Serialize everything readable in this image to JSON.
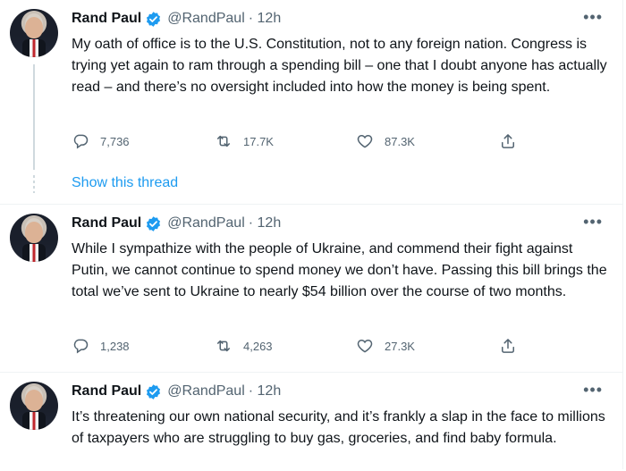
{
  "tweets": [
    {
      "name": "Rand Paul",
      "handle": "@RandPaul",
      "time": "· 12h",
      "text": "My oath of office is to the U.S. Constitution, not to any foreign nation. Congress is trying yet again to ram through a spending bill – one that I doubt anyone has actually read – and there’s no oversight included into how the money is being spent.",
      "replies": "7,736",
      "retweets": "17.7K",
      "likes": "87.3K"
    },
    {
      "name": "Rand Paul",
      "handle": "@RandPaul",
      "time": "· 12h",
      "text": "While I sympathize with the people of Ukraine, and commend their fight against Putin, we cannot continue to spend money we don’t have. Passing this bill brings the total we’ve sent to Ukraine to nearly $54 billion over the course of two months.",
      "replies": "1,238",
      "retweets": "4,263",
      "likes": "27.3K"
    },
    {
      "name": "Rand Paul",
      "handle": "@RandPaul",
      "time": "· 12h",
      "text": "It’s threatening our own national security, and it’s frankly a slap in the face to millions of taxpayers who are struggling to buy gas, groceries, and find baby formula."
    }
  ],
  "show_thread": "Show this thread",
  "more_glyph": "•••",
  "colors": {
    "accent": "#1d9bf0",
    "muted": "#536471",
    "text": "#0f1419",
    "thread_line": "#cfd9de"
  },
  "icons": [
    "verified-badge-icon",
    "reply-icon",
    "retweet-icon",
    "like-icon",
    "share-icon",
    "more-icon"
  ]
}
